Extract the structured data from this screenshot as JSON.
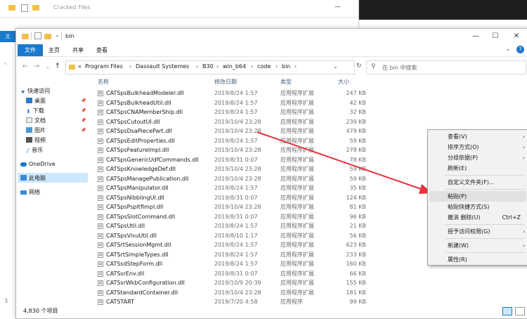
{
  "background_window": {
    "title": "Cracked Files",
    "tab_label": "文"
  },
  "window": {
    "title": "bin",
    "controls": {
      "minimize": "—",
      "maximize": "☐",
      "close": "✕",
      "help": "?",
      "expand": "⌄"
    }
  },
  "ribbon": {
    "tabs": [
      "文件",
      "主页",
      "共享",
      "查看"
    ]
  },
  "nav_buttons": {
    "back": "←",
    "forward": "→",
    "recent": "⌄",
    "up": "↑"
  },
  "address": {
    "crumbs": [
      "«",
      "Program Files",
      "Dassault Systemes",
      "B30",
      "win_b64",
      "code",
      "bin"
    ],
    "separator": "›",
    "dropdown": "⌄",
    "refresh": "↻"
  },
  "search": {
    "placeholder": "在 bin 中搜索"
  },
  "nav_pane": {
    "quick_access": "快速访问",
    "pinned": [
      "桌面",
      "下载",
      "文档",
      "图片"
    ],
    "recent": [
      "视频",
      "音乐"
    ],
    "onedrive": "OneDrive",
    "this_pc": "此电脑",
    "network": "网络",
    "pin_glyph": "📌"
  },
  "columns": {
    "name": "名称",
    "date": "修改日期",
    "type": "类型",
    "size": "大小"
  },
  "files": [
    {
      "name": "CATSpsBulkheadModeler.dll",
      "date": "2019/8/24 1:57",
      "type": "应用程序扩展",
      "size": "247 KB"
    },
    {
      "name": "CATSpsBulkheadUtil.dll",
      "date": "2019/8/24 1:57",
      "type": "应用程序扩展",
      "size": "42 KB"
    },
    {
      "name": "CATSpsCNAMemberShip.dll",
      "date": "2019/8/24 1:57",
      "type": "应用程序扩展",
      "size": "32 KB"
    },
    {
      "name": "CATSpsCutoutUI.dll",
      "date": "2019/10/4 23:28",
      "type": "应用程序扩展",
      "size": "239 KB"
    },
    {
      "name": "CATSpsDsaPiecePart.dll",
      "date": "2019/10/4 23:28",
      "type": "应用程序扩展",
      "size": "479 KB"
    },
    {
      "name": "CATSpsEditProperties.dll",
      "date": "2019/8/24 1:57",
      "type": "应用程序扩展",
      "size": "59 KB"
    },
    {
      "name": "CATSpsFeatureImpl.dll",
      "date": "2019/10/4 23:28",
      "type": "应用程序扩展",
      "size": "278 KB"
    },
    {
      "name": "CATSpsGenericUdfCommands.dll",
      "date": "2019/8/31 0:07",
      "type": "应用程序扩展",
      "size": "78 KB"
    },
    {
      "name": "CATSpsKnowledgeDef.dll",
      "date": "2019/10/4 23:28",
      "type": "应用程序扩展",
      "size": "59 KB"
    },
    {
      "name": "CATSpsManagePublication.dll",
      "date": "2019/10/4 23:28",
      "type": "应用程序扩展",
      "size": "59 KB"
    },
    {
      "name": "CATSpsManipulator.dll",
      "date": "2019/8/24 1:57",
      "type": "应用程序扩展",
      "size": "35 KB"
    },
    {
      "name": "CATSpsNibblingUI.dll",
      "date": "2019/8/31 0:07",
      "type": "应用程序扩展",
      "size": "124 KB"
    },
    {
      "name": "CATSpsPspltfImpl.dll",
      "date": "2019/10/4 23:28",
      "type": "应用程序扩展",
      "size": "81 KB"
    },
    {
      "name": "CATSpsSlotCommand.dll",
      "date": "2019/8/31 0:07",
      "type": "应用程序扩展",
      "size": "96 KB"
    },
    {
      "name": "CATSpsUtil.dll",
      "date": "2019/8/24 1:57",
      "type": "应用程序扩展",
      "size": "21 KB"
    },
    {
      "name": "CATSpsVisuUtil.dll",
      "date": "2019/8/10 1:17",
      "type": "应用程序扩展",
      "size": "56 KB"
    },
    {
      "name": "CATSrtSessionMgmt.dll",
      "date": "2019/8/24 1:57",
      "type": "应用程序扩展",
      "size": "623 KB"
    },
    {
      "name": "CATSrtSimpleTypes.dll",
      "date": "2019/8/24 1:57",
      "type": "应用程序扩展",
      "size": "233 KB"
    },
    {
      "name": "CATSsdStepForm.dll",
      "date": "2019/8/24 1:57",
      "type": "应用程序扩展",
      "size": "160 KB"
    },
    {
      "name": "CATSsrEnv.dll",
      "date": "2019/8/31 0:07",
      "type": "应用程序扩展",
      "size": "66 KB"
    },
    {
      "name": "CATSsrWkbConfiguration.dll",
      "date": "2019/10/9 20:39",
      "type": "应用程序扩展",
      "size": "155 KB"
    },
    {
      "name": "CATStandardContainer.dll",
      "date": "2019/10/4 23:28",
      "type": "应用程序扩展",
      "size": "181 KB"
    },
    {
      "name": "CATSTART",
      "date": "2019/7/20 4:58",
      "type": "应用程序",
      "size": "99 KB"
    }
  ],
  "status": {
    "count": "4,830 个项目"
  },
  "context_menu": {
    "items": [
      {
        "label": "查看(V)",
        "arrow": "›"
      },
      {
        "label": "排序方式(O)",
        "arrow": "›"
      },
      {
        "label": "分组依据(P)",
        "arrow": "›"
      },
      {
        "label": "刷新(E)"
      },
      {
        "sep": true
      },
      {
        "label": "自定义文件夹(F)..."
      },
      {
        "sep": true
      },
      {
        "label": "粘贴(P)"
      },
      {
        "label": "粘贴快捷方式(S)"
      },
      {
        "label": "撤消 删除(U)",
        "shortcut": "Ctrl+Z"
      },
      {
        "sep": true
      },
      {
        "label": "授予访问权限(G)",
        "arrow": "›"
      },
      {
        "sep": true
      },
      {
        "label": "新建(W)",
        "arrow": "›"
      },
      {
        "sep": true
      },
      {
        "label": "属性(R)"
      }
    ]
  },
  "colors": {
    "accent": "#1979ca",
    "selection": "#cce8ff",
    "arrow": "#e8323c",
    "folder": "#f2c048"
  }
}
